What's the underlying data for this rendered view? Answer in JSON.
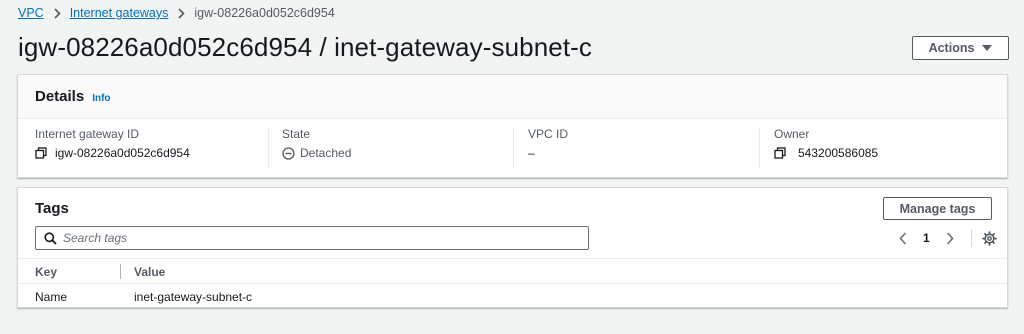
{
  "breadcrumb": {
    "items": [
      {
        "label": "VPC"
      },
      {
        "label": "Internet gateways"
      },
      {
        "label": "igw-08226a0d052c6d954"
      }
    ]
  },
  "page": {
    "title": "igw-08226a0d052c6d954 / inet-gateway-subnet-c",
    "actions_label": "Actions"
  },
  "details": {
    "title": "Details",
    "info_label": "Info",
    "columns": [
      {
        "label": "Internet gateway ID",
        "value": "igw-08226a0d052c6d954",
        "icon": "copy-icon"
      },
      {
        "label": "State",
        "value": "Detached",
        "icon": "detached-status-icon"
      },
      {
        "label": "VPC ID",
        "value": "–"
      },
      {
        "label": "Owner",
        "value": "543200586085",
        "icon": "copy-icon"
      }
    ]
  },
  "tags": {
    "title": "Tags",
    "manage_label": "Manage tags",
    "search_placeholder": "Search tags",
    "page_number": "1",
    "columns": [
      "Key",
      "Value"
    ],
    "rows": [
      {
        "key": "Name",
        "value": "inet-gateway-subnet-c"
      }
    ]
  },
  "colors": {
    "link": "#0073bb",
    "background": "#f2f3f3",
    "text": "#16191f",
    "muted": "#545b64"
  }
}
